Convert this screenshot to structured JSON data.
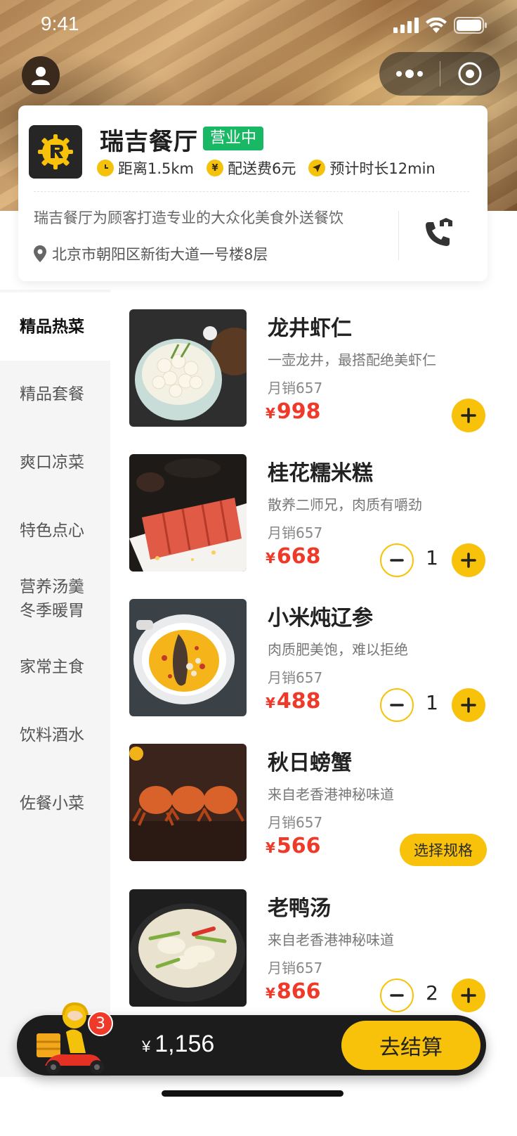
{
  "status_bar": {
    "time": "9:41"
  },
  "store": {
    "name": "瑞吉餐厅",
    "status_badge": "营业中",
    "distance": "距离1.5km",
    "delivery_fee": "配送费6元",
    "eta": "预计时长12min",
    "description": "瑞吉餐厅为顾客打造专业的大众化美食外送餐饮",
    "address": "北京市朝阳区新街大道一号楼8层"
  },
  "categories": [
    {
      "label": "精品热菜",
      "active": true
    },
    {
      "label": "精品套餐"
    },
    {
      "label": "爽口凉菜"
    },
    {
      "label": "特色点心"
    },
    {
      "label": "营养汤羹\n冬季暖胃"
    },
    {
      "label": "家常主食"
    },
    {
      "label": "饮料酒水"
    },
    {
      "label": "佐餐小菜"
    }
  ],
  "items": [
    {
      "name": "龙井虾仁",
      "desc": "一壶龙井，最搭配绝美虾仁",
      "sales": "月销657",
      "currency": "¥",
      "price": "998"
    },
    {
      "name": "桂花糯米糕",
      "desc": "散养二师兄，肉质有嚼劲",
      "sales": "月销657",
      "currency": "¥",
      "price": "668",
      "qty": "1"
    },
    {
      "name": "小米炖辽参",
      "desc": "肉质肥美饱，难以拒绝",
      "sales": "月销657",
      "currency": "¥",
      "price": "488",
      "qty": "1"
    },
    {
      "name": "秋日螃蟹",
      "desc": "来自老香港神秘味道",
      "sales": "月销657",
      "currency": "¥",
      "price": "566",
      "spec_label": "选择规格"
    },
    {
      "name": "老鸭汤",
      "desc": "来自老香港神秘味道",
      "sales": "月销657",
      "currency": "¥",
      "price": "866",
      "qty": "2"
    }
  ],
  "cart": {
    "count": "3",
    "currency": "¥",
    "total": "1,156",
    "checkout_label": "去结算"
  },
  "colors": {
    "accent": "#f8c20a",
    "price": "#ef3a2a",
    "badge": "#19b865"
  }
}
